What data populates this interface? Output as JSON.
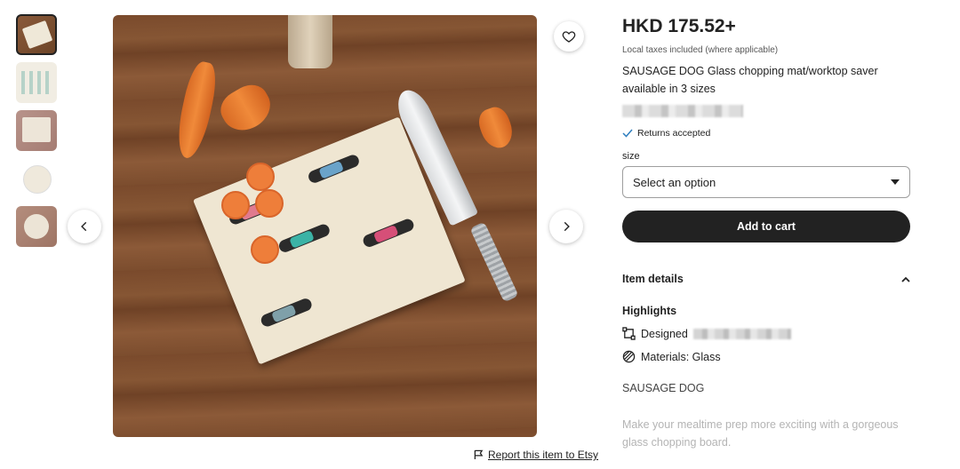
{
  "gallery": {
    "thumbnails": [
      "thumb-1",
      "thumb-2",
      "thumb-3",
      "thumb-4",
      "thumb-5"
    ],
    "selected_index": 0
  },
  "report_link": "Report this item to Etsy",
  "product": {
    "price": "HKD 175.52+",
    "taxes_note": "Local taxes included (where applicable)",
    "title": "SAUSAGE DOG Glass chopping mat/worktop saver available in 3 sizes",
    "returns": "Returns accepted",
    "size_label": "size",
    "size_select_value": "Select an option",
    "add_to_cart": "Add to cart"
  },
  "details": {
    "heading": "Item details",
    "highlights_heading": "Highlights",
    "designed_label": "Designed",
    "materials": "Materials: Glass",
    "subtitle": "SAUSAGE DOG",
    "description": "Make your mealtime prep more exciting with a gorgeous glass chopping board."
  },
  "icons": {
    "favorite": "heart-icon",
    "prev": "chevron-left-icon",
    "next": "chevron-right-icon",
    "flag": "flag-icon",
    "check": "check-icon",
    "dropdown": "caret-down-icon",
    "collapse": "chevron-up-icon",
    "designed": "design-icon",
    "materials": "materials-icon"
  },
  "colors": {
    "button_bg": "#222222",
    "text": "#222222",
    "muted": "#595959",
    "check": "#2f7fbf"
  }
}
